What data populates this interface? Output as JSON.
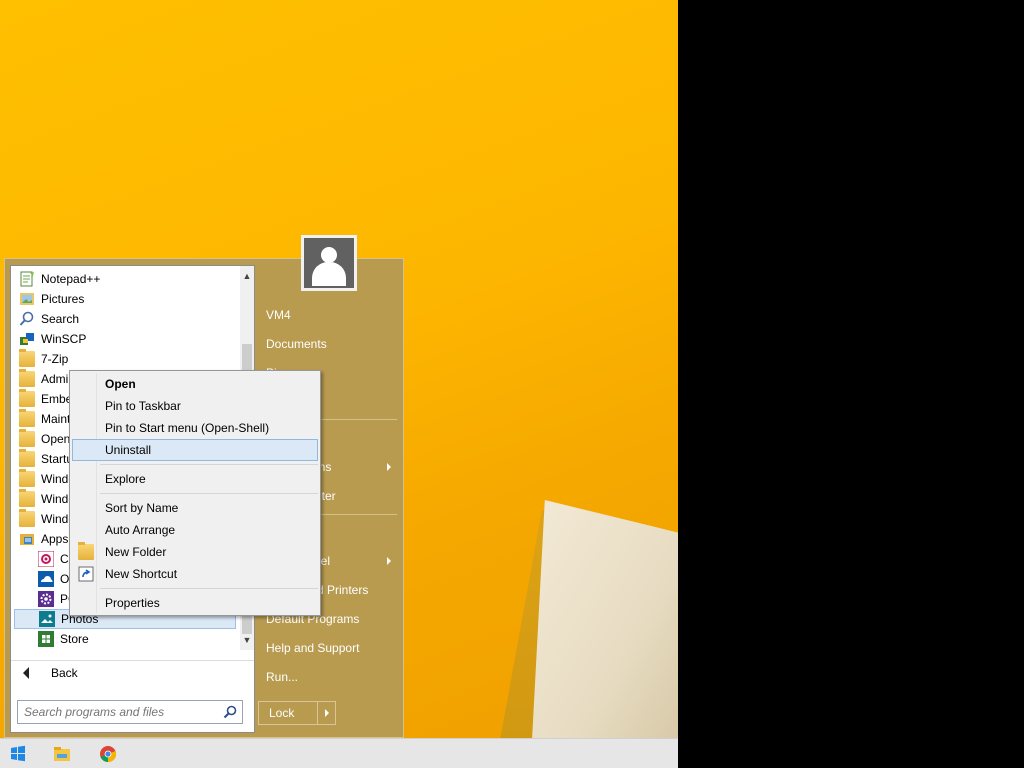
{
  "desktop": {
    "accent": "#FDB600"
  },
  "start_menu": {
    "programs": [
      {
        "label": "Notepad++",
        "icon": "notepadpp-icon"
      },
      {
        "label": "Pictures",
        "icon": "pictures-icon"
      },
      {
        "label": "Search",
        "icon": "search-icon"
      },
      {
        "label": "WinSCP",
        "icon": "winscp-icon"
      },
      {
        "label": "7-Zip",
        "icon": "folder-icon"
      },
      {
        "label": "Admi",
        "icon": "folder-icon"
      },
      {
        "label": "Embe",
        "icon": "folder-icon"
      },
      {
        "label": "Maint",
        "icon": "folder-icon"
      },
      {
        "label": "Open",
        "icon": "folder-icon"
      },
      {
        "label": "Startu",
        "icon": "folder-icon"
      },
      {
        "label": "Windo",
        "icon": "folder-icon"
      },
      {
        "label": "Windo",
        "icon": "folder-icon"
      },
      {
        "label": "Windo",
        "icon": "folder-icon"
      },
      {
        "label": "Apps",
        "icon": "apps-folder-icon"
      },
      {
        "label": "Ca",
        "icon": "camera-app-icon"
      },
      {
        "label": "Or",
        "icon": "onedrive-app-icon"
      },
      {
        "label": "PC",
        "icon": "pc-settings-icon"
      },
      {
        "label": "Photos",
        "icon": "photos-app-icon"
      },
      {
        "label": "Store",
        "icon": "store-app-icon"
      }
    ],
    "back_label": "Back",
    "search_placeholder": "Search programs and files",
    "right_items": [
      {
        "label": "VM4"
      },
      {
        "label": "Documents"
      },
      {
        "label": "Pi"
      },
      {
        "label": "ons"
      },
      {
        "label": "uter"
      },
      {
        "label": "nel"
      },
      {
        "label": "d Printers"
      },
      {
        "label": "Default Programs"
      },
      {
        "label": "Help and Support"
      },
      {
        "label": "Run..."
      }
    ],
    "lock_label": "Lock"
  },
  "context_menu": {
    "items": [
      {
        "label": "Open"
      },
      {
        "label": "Pin to Taskbar"
      },
      {
        "label": "Pin to Start menu (Open-Shell)"
      },
      {
        "label": "Uninstall"
      },
      {
        "label": "Explore"
      },
      {
        "label": "Sort by Name"
      },
      {
        "label": "Auto Arrange"
      },
      {
        "label": "New Folder"
      },
      {
        "label": "New Shortcut"
      },
      {
        "label": "Properties"
      }
    ]
  },
  "taskbar": {
    "buttons": [
      {
        "icon": "windows-start-icon"
      },
      {
        "icon": "file-explorer-icon"
      },
      {
        "icon": "chrome-icon"
      }
    ]
  }
}
